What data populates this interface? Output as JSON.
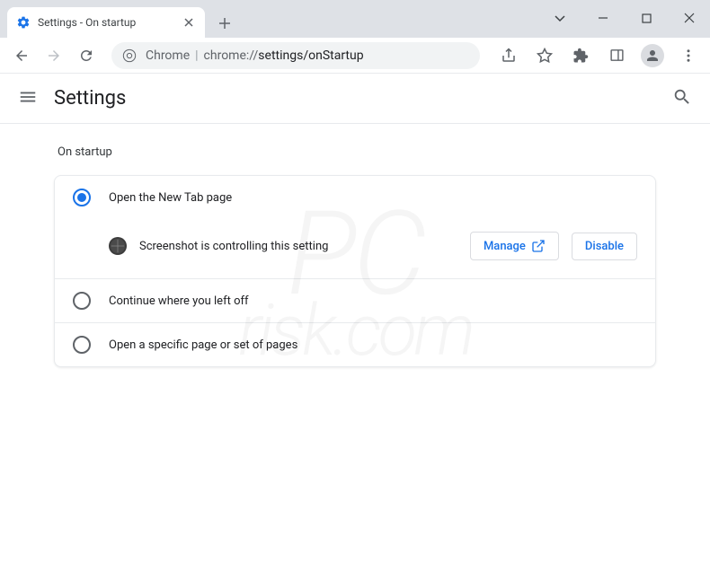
{
  "tab": {
    "title": "Settings - On startup"
  },
  "omnibox": {
    "prefix": "Chrome",
    "scheme": "chrome://",
    "path": "settings/onStartup"
  },
  "header": {
    "title": "Settings"
  },
  "section": {
    "title": "On startup"
  },
  "radios": {
    "option1": "Open the New Tab page",
    "option2": "Continue where you left off",
    "option3": "Open a specific page or set of pages"
  },
  "extension_notice": {
    "text": "Screenshot is controlling this setting",
    "manage_label": "Manage",
    "disable_label": "Disable"
  },
  "watermark": {
    "line1": "PC",
    "line2": "risk.com"
  }
}
